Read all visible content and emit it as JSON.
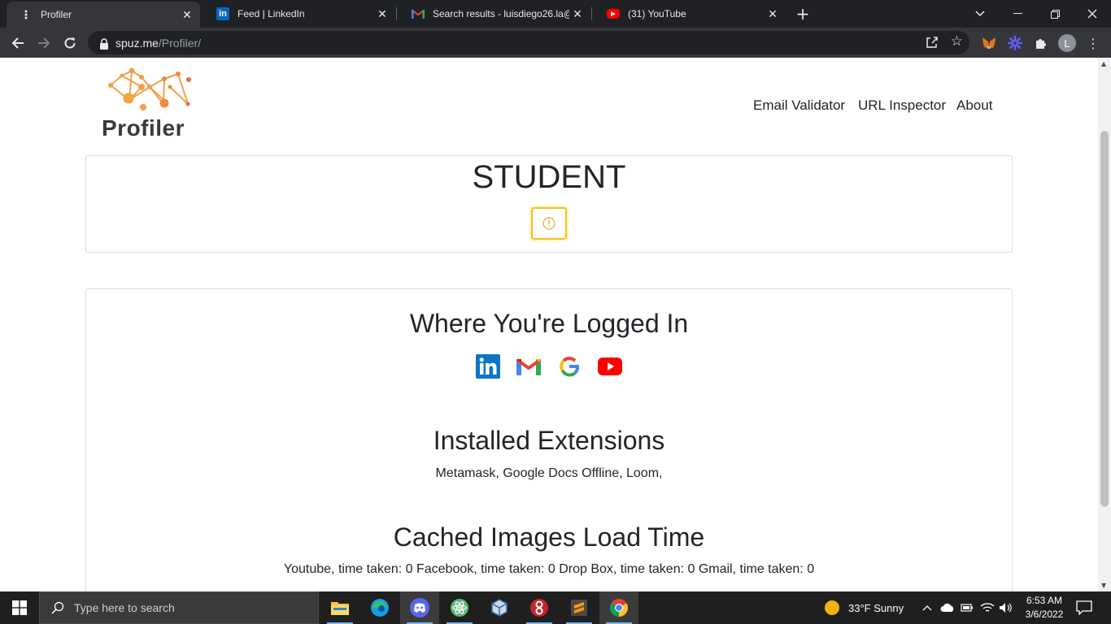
{
  "browser": {
    "tabs": [
      {
        "title": "Profiler",
        "icon": "profiler-icon",
        "active": true
      },
      {
        "title": "Feed | LinkedIn",
        "icon": "linkedin-icon",
        "active": false
      },
      {
        "title": "Search results - luisdiego26.la@g",
        "icon": "gmail-icon",
        "active": false
      },
      {
        "title": "(31) YouTube",
        "icon": "youtube-icon",
        "active": false
      }
    ],
    "url_host": "spuz.me",
    "url_path": "/Profiler/",
    "profile_initial": "L"
  },
  "site": {
    "logo_text": "Profiler",
    "nav": [
      "Email Validator",
      "URL Inspector",
      "About"
    ]
  },
  "profile": {
    "label": "STUDENT",
    "info_icon": "info-icon"
  },
  "sections": {
    "logged_in": {
      "title": "Where You're Logged In",
      "services": [
        "linkedin",
        "gmail",
        "google",
        "youtube"
      ]
    },
    "extensions": {
      "title": "Installed Extensions",
      "text": "Metamask, Google Docs Offline, Loom,"
    },
    "cached": {
      "title": "Cached Images Load Time",
      "text": "Youtube, time taken: 0 Facebook, time taken: 0 Drop Box, time taken: 0 Gmail, time taken: 0"
    }
  },
  "taskbar": {
    "search_placeholder": "Type here to search",
    "weather": "33°F  Sunny",
    "time": "6:53 AM",
    "date": "3/6/2022"
  },
  "colors": {
    "chrome_dark": "#202124",
    "chrome_toolbar": "#35363a",
    "logo_orange": "#f0a04b",
    "info_border": "#f0c419"
  }
}
